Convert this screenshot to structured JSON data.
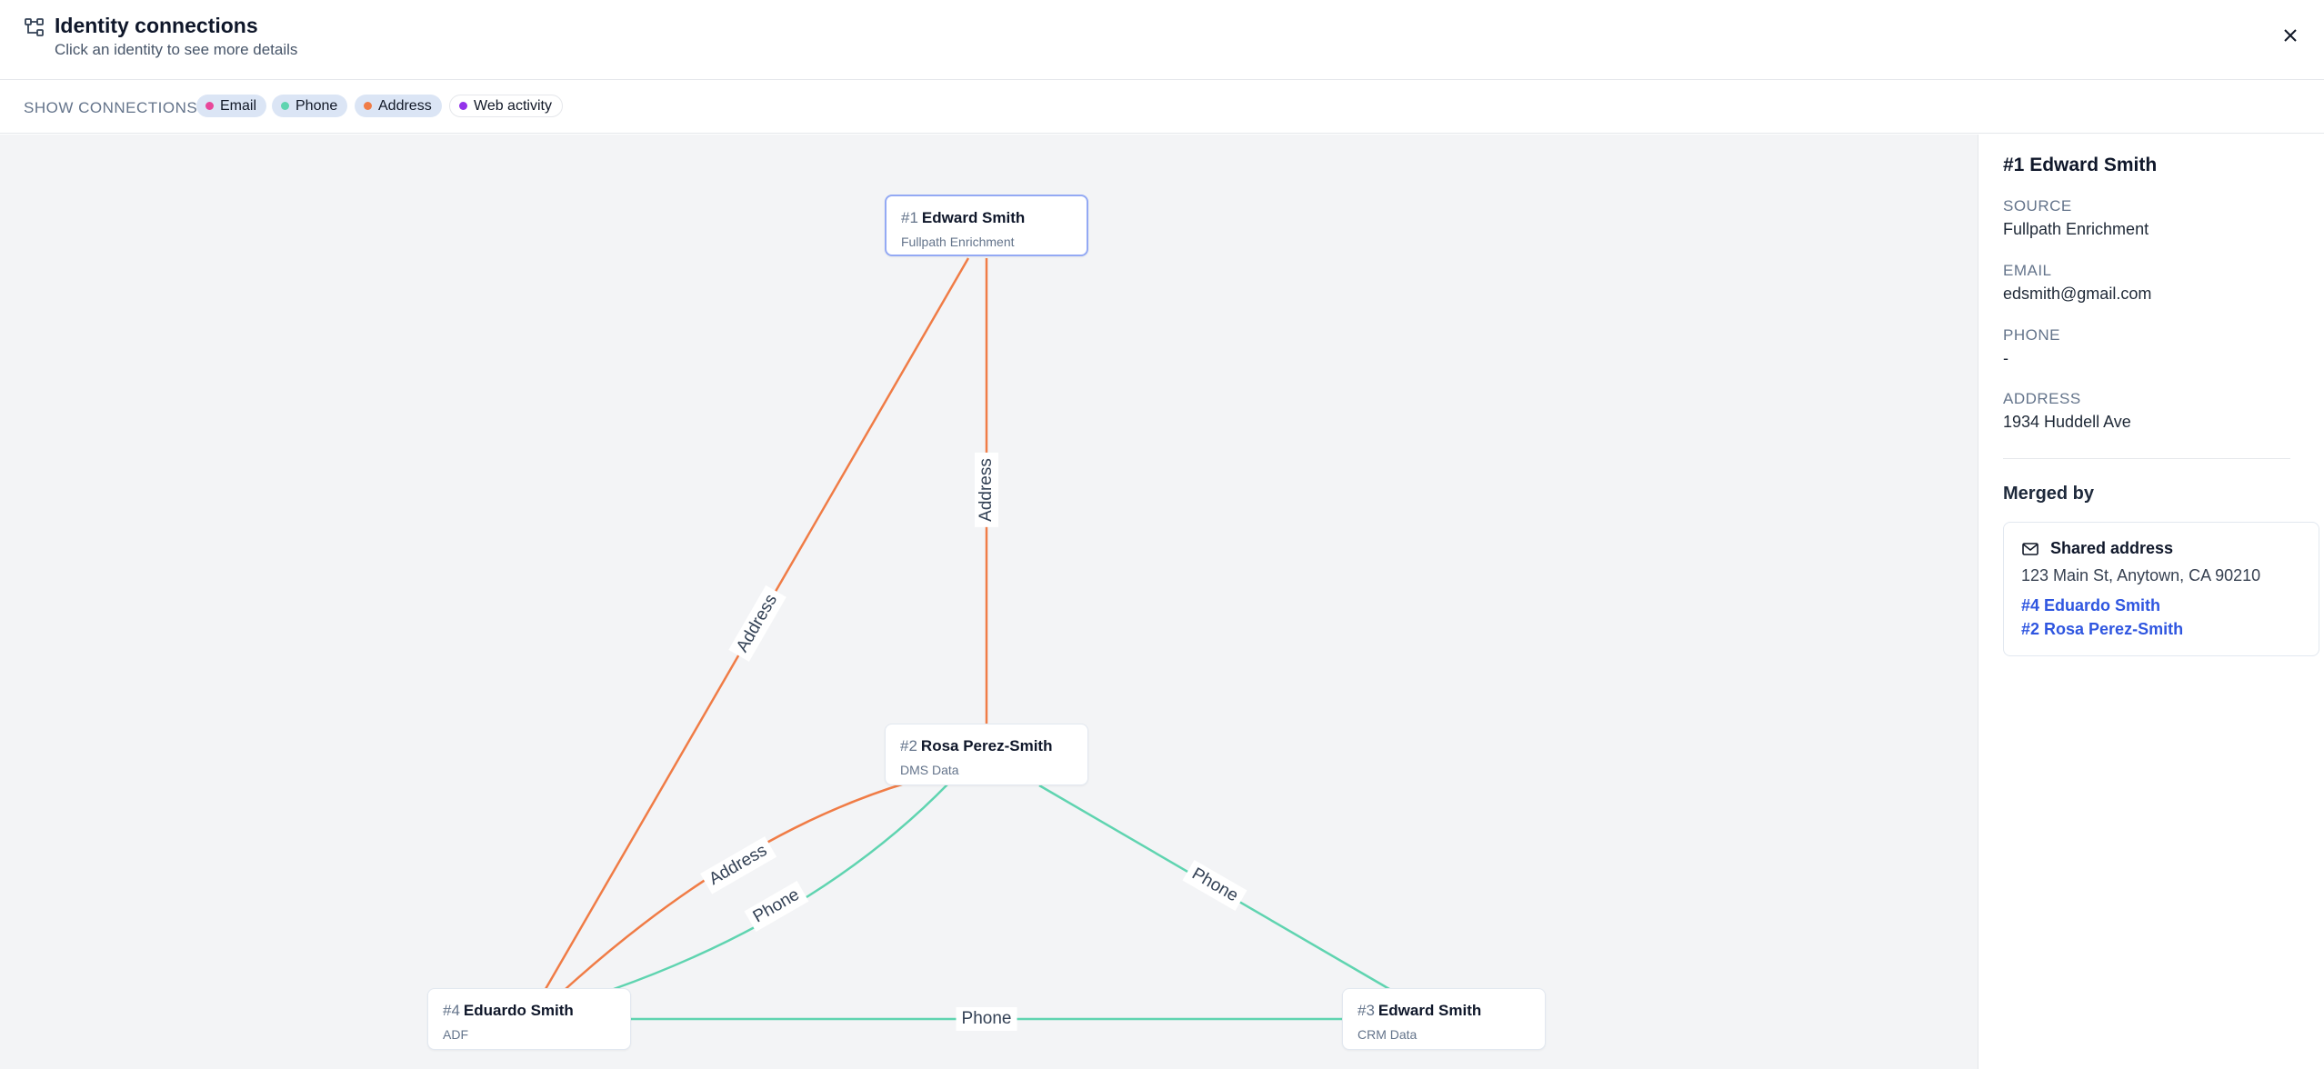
{
  "header": {
    "title": "Identity connections",
    "subtitle": "Click an identity to see more details",
    "icon": "graph-nodes-icon",
    "close_icon": "close-icon"
  },
  "filters": {
    "label": "SHOW CONNECTIONS",
    "chips": [
      {
        "label": "Email",
        "color": "#e8479a",
        "active": true
      },
      {
        "label": "Phone",
        "color": "#5fd4b0",
        "active": true
      },
      {
        "label": "Address",
        "color": "#f07c46",
        "active": true
      },
      {
        "label": "Web activity",
        "color": "#9333ea",
        "active": false
      }
    ]
  },
  "colors": {
    "address": "#f07c46",
    "phone": "#5fd4b0",
    "link": "#2f56e0",
    "selected_border": "#93a9f4"
  },
  "graph": {
    "nodes": [
      {
        "num": "#1",
        "name": "Edward Smith",
        "source": "Fullpath Enrichment",
        "selected": true
      },
      {
        "num": "#2",
        "name": "Rosa Perez-Smith",
        "source": "DMS Data",
        "selected": false
      },
      {
        "num": "#3",
        "name": "Edward Smith",
        "source": "CRM Data",
        "selected": false
      },
      {
        "num": "#4",
        "name": "Eduardo Smith",
        "source": "ADF",
        "selected": false
      }
    ],
    "edges": [
      {
        "from": "#1",
        "to": "#2",
        "type": "Address"
      },
      {
        "from": "#1",
        "to": "#4",
        "type": "Address"
      },
      {
        "from": "#2",
        "to": "#4",
        "type": "Address"
      },
      {
        "from": "#2",
        "to": "#4",
        "type": "Phone"
      },
      {
        "from": "#2",
        "to": "#3",
        "type": "Phone"
      },
      {
        "from": "#4",
        "to": "#3",
        "type": "Phone"
      }
    ]
  },
  "details": {
    "title": "#1 Edward Smith",
    "source_label": "SOURCE",
    "source_value": "Fullpath Enrichment",
    "email_label": "EMAIL",
    "email_value": "edsmith@gmail.com",
    "phone_label": "PHONE",
    "phone_value": "-",
    "address_label": "ADDRESS",
    "address_value": "1934 Huddell Ave",
    "merged_by_label": "Merged by",
    "merge": {
      "icon": "mail-icon",
      "title": "Shared address",
      "address": "123 Main St, Anytown, CA 90210",
      "links": [
        "#4 Eduardo Smith",
        "#2 Rosa Perez-Smith"
      ]
    }
  }
}
